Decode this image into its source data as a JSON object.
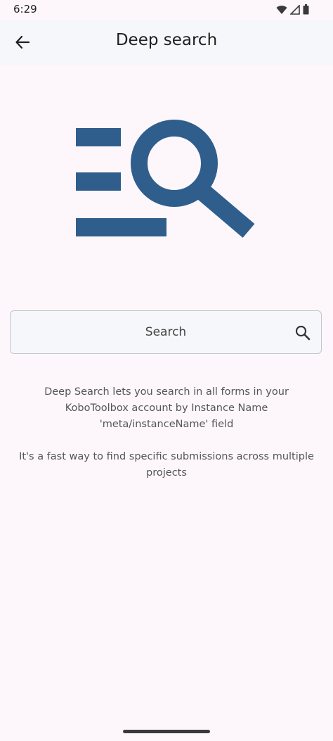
{
  "status_bar": {
    "time": "6:29",
    "icons": [
      "wifi-icon",
      "cellular-signal-icon",
      "battery-icon"
    ]
  },
  "app_bar": {
    "back_icon": "arrow-back-icon",
    "title": "Deep search"
  },
  "hero": {
    "icon": "deep-search-illustration",
    "color": "#2f5e8c"
  },
  "search": {
    "label": "Search",
    "icon": "search-icon"
  },
  "description": {
    "line1": "Deep Search lets you search in all forms in your KoboToolbox account by Instance Name 'meta/instanceName' field",
    "line2": "It's a fast way to find specific submissions across multiple projects"
  },
  "colors": {
    "background": "#fdf7fb",
    "app_bar": "#f6f7fa",
    "accent": "#2f5e8c"
  }
}
